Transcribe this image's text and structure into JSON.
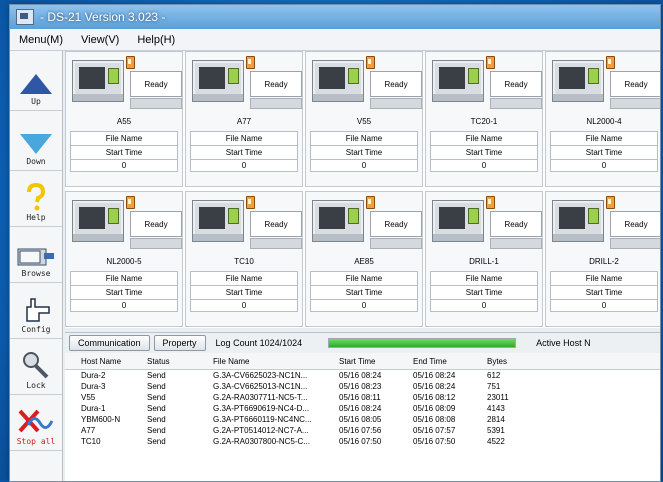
{
  "window": {
    "title": "- DS-21 Version 3.023 -"
  },
  "menu": [
    "Menu(M)",
    "View(V)",
    "Help(H)"
  ],
  "toolbar": [
    {
      "label": "Up",
      "icon": "up-arrow-icon"
    },
    {
      "label": "Down",
      "icon": "down-arrow-icon"
    },
    {
      "label": "Help",
      "icon": "question-icon"
    },
    {
      "label": "Browse",
      "icon": "folder-icon"
    },
    {
      "label": "Config",
      "icon": "hand-pointer-icon"
    },
    {
      "label": "Lock",
      "icon": "key-icon"
    },
    {
      "label": "Stop all",
      "icon": "stop-wave-icon"
    }
  ],
  "hosts": [
    {
      "name": "A55",
      "status": "Ready",
      "file_label": "File Name",
      "time_label": "Start Time",
      "count": "0"
    },
    {
      "name": "A77",
      "status": "Ready",
      "file_label": "File Name",
      "time_label": "Start Time",
      "count": "0"
    },
    {
      "name": "V55",
      "status": "Ready",
      "file_label": "File Name",
      "time_label": "Start Time",
      "count": "0"
    },
    {
      "name": "TC20-1",
      "status": "Ready",
      "file_label": "File Name",
      "time_label": "Start Time",
      "count": "0"
    },
    {
      "name": "NL2000-4",
      "status": "Ready",
      "file_label": "File Name",
      "time_label": "Start Time",
      "count": "0"
    },
    {
      "name": "NL2000-5",
      "status": "Ready",
      "file_label": "File Name",
      "time_label": "Start Time",
      "count": "0"
    },
    {
      "name": "TC10",
      "status": "Ready",
      "file_label": "File Name",
      "time_label": "Start Time",
      "count": "0"
    },
    {
      "name": "AE85",
      "status": "Ready",
      "file_label": "File Name",
      "time_label": "Start Time",
      "count": "0"
    },
    {
      "name": "DRILL-1",
      "status": "Ready",
      "file_label": "File Name",
      "time_label": "Start Time",
      "count": "0"
    },
    {
      "name": "DRILL-2",
      "status": "Ready",
      "file_label": "File Name",
      "time_label": "Start Time",
      "count": "0"
    }
  ],
  "log": {
    "tabs": [
      "Communication",
      "Property"
    ],
    "count": "Log Count 1024/1024",
    "progress": 100,
    "active_host": "Active Host N",
    "headers": [
      "Host Name",
      "Status",
      "File Name",
      "Start Time",
      "End Time",
      "Bytes"
    ],
    "rows": [
      [
        "Dura-2",
        "Send",
        "G.3A-CV6625023-NC1N...",
        "05/16 08:24",
        "05/16 08:24",
        "612"
      ],
      [
        "Dura-3",
        "Send",
        "G.3A-CV6625013-NC1N...",
        "05/16 08:23",
        "05/16 08:24",
        "751"
      ],
      [
        "V55",
        "Send",
        "G.2A-RA0307711-NC5-T...",
        "05/16 08:11",
        "05/16 08:12",
        "23011"
      ],
      [
        "Dura-1",
        "Send",
        "G.3A-PT6690619-NC4-D...",
        "05/16 08:24",
        "05/16 08:09",
        "4143"
      ],
      [
        "YBM600-N",
        "Send",
        "G.3A-PT6660119-NC4NC...",
        "05/16 08:05",
        "05/16 08:08",
        "2814"
      ],
      [
        "A77",
        "Send",
        "G.2A-PT0514012-NC7-A...",
        "05/16 07:56",
        "05/16 07:57",
        "5391"
      ],
      [
        "TC10",
        "Send",
        "G.2A-RA0307800-NC5-C...",
        "05/16 07:50",
        "05/16 07:50",
        "4522"
      ]
    ]
  }
}
